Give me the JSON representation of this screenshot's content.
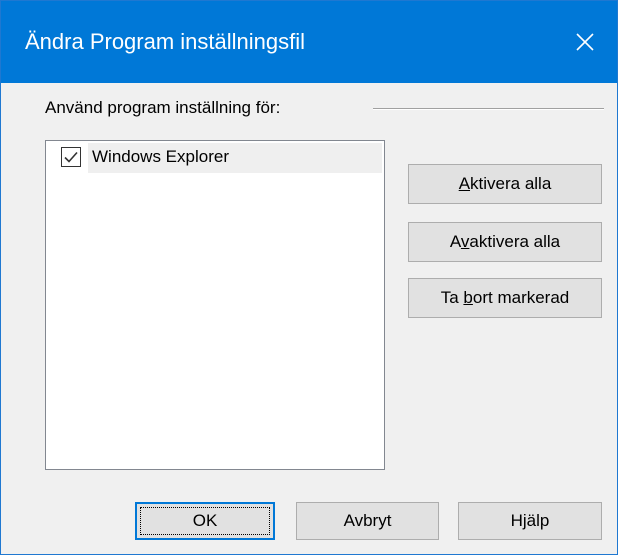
{
  "window": {
    "title": "Ändra Program inställningsfil",
    "close_icon": "close-icon",
    "colors": {
      "titlebar": "#0078d7",
      "title_text": "#ffffff",
      "dialog_bg": "#f0f0f0"
    }
  },
  "group": {
    "label": "Använd program inställning för:"
  },
  "list": {
    "items": [
      {
        "label": "Windows Explorer",
        "checked": true
      }
    ]
  },
  "buttons": {
    "enable_all": {
      "before": "",
      "mnemonic": "A",
      "after": "ktivera alla"
    },
    "disable_all": {
      "before": "A",
      "mnemonic": "v",
      "after": "aktivera alla"
    },
    "remove_selected": {
      "before": "Ta ",
      "mnemonic": "b",
      "after": "ort markerad"
    },
    "ok": "OK",
    "cancel": "Avbryt",
    "help": "Hjälp"
  }
}
